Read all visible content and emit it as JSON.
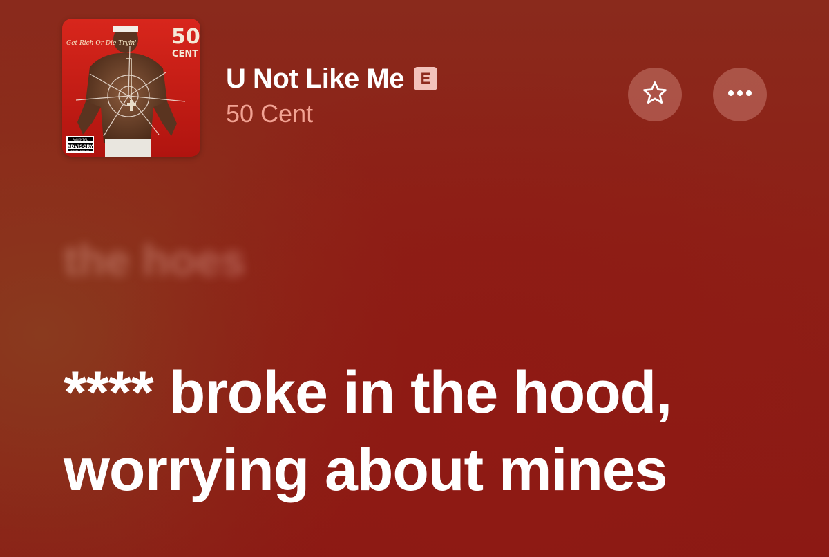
{
  "track": {
    "title": "U Not Like Me",
    "explicit_badge": "E",
    "artist": "50 Cent"
  },
  "album_art": {
    "artist_text": "50",
    "artist_subtext": "CENT",
    "album_title": "Get Rich Or Die Tryin'",
    "advisory_top": "PARENTAL",
    "advisory_mid": "ADVISORY",
    "advisory_bottom": "EXPLICIT CONTENT"
  },
  "buttons": {
    "favorite_icon": "star-icon",
    "more_icon": "ellipsis-icon"
  },
  "lyrics": {
    "past_line": "the hoes",
    "current_line_1": "**** broke in the hood,",
    "current_line_2": "worrying about mines"
  },
  "colors": {
    "background": "#8e1f16",
    "explicit_badge_bg": "#f3c2bb",
    "artist_text": "#f2a293"
  }
}
